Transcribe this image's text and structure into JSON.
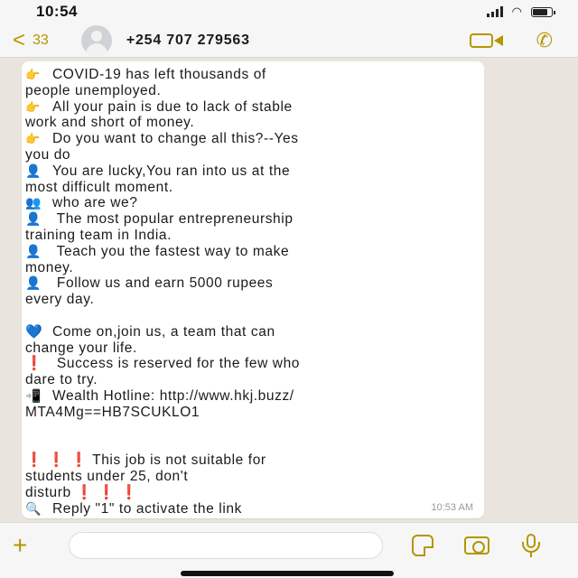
{
  "status_bar": {
    "time": "10:54",
    "battery_level": 0.8
  },
  "header": {
    "back_chevron": "<",
    "back_count": "33",
    "contact_name": "+254 707 279563",
    "icons": {
      "back": "chevron-left-icon",
      "video": "video-call-icon",
      "phone": "phone-call-icon"
    }
  },
  "message": {
    "lines": [
      {
        "emoji": "👉",
        "emoji_name": "pointing-finger-icon",
        "text": "COVID-19 has left thousands of"
      },
      {
        "emoji": "",
        "text": "people unemployed."
      },
      {
        "emoji": "👉",
        "emoji_name": "pointing-finger-icon",
        "text": "All your pain is due to lack of stable"
      },
      {
        "emoji": "",
        "text": "work and short of money."
      },
      {
        "emoji": "👉",
        "emoji_name": "pointing-finger-icon",
        "text": "Do you want to change all this?--Yes"
      },
      {
        "emoji": "",
        "text": "you do"
      },
      {
        "emoji": "👤",
        "emoji_name": "person-icon",
        "text": "You are lucky,You ran into us at the"
      },
      {
        "emoji": "",
        "text": "most difficult moment."
      },
      {
        "emoji": "👥",
        "emoji_name": "people-icon",
        "text": "who are we?"
      },
      {
        "emoji": "👤",
        "emoji_name": "person-icon",
        "text": " The most popular entrepreneurship"
      },
      {
        "emoji": "",
        "text": "training team in India."
      },
      {
        "emoji": "👤",
        "emoji_name": "person-icon",
        "text": " Teach you the fastest way to make"
      },
      {
        "emoji": "",
        "text": "money."
      },
      {
        "emoji": "👤",
        "emoji_name": "person-icon",
        "text": " Follow us and earn 5000 rupees"
      },
      {
        "emoji": "",
        "text": "every day."
      },
      {
        "gap": true
      },
      {
        "emoji": "💙",
        "emoji_name": "blue-heart-icon",
        "text": "Come on,join us, a team that can"
      },
      {
        "emoji": "",
        "text": "change your life."
      },
      {
        "emoji": "❗",
        "emoji_name": "exclamation-icon",
        "text": " Success is reserved for the few who"
      },
      {
        "emoji": "",
        "text": "dare to try."
      },
      {
        "emoji": "📲",
        "emoji_name": "mobile-phone-icon",
        "text": "Wealth Hotline:  http://www.hkj.buzz/"
      },
      {
        "emoji": "",
        "text": "MTA4Mg==HB7SCUKLO1"
      },
      {
        "gap": true
      },
      {
        "gap": true
      },
      {
        "emoji": "❗ ❗ ❗",
        "emoji_name": "exclamation-icon",
        "text": " This job is not suitable for"
      },
      {
        "emoji": "",
        "text": "students under 25, don't"
      },
      {
        "emoji": "",
        "text": "disturb ❗ ❗ ❗"
      },
      {
        "emoji": "🔍",
        "emoji_name": "magnifier-icon",
        "text": "Reply \"1\" to activate the link"
      }
    ],
    "timestamp": "10:53 AM"
  },
  "input_bar": {
    "placeholder": "",
    "icons": {
      "plus": "plus-icon",
      "sticker": "sticker-icon",
      "camera": "camera-icon",
      "mic": "microphone-icon"
    },
    "plus_symbol": "+"
  },
  "colors": {
    "accent": "#b49600",
    "chat_background": "#e9e5de",
    "bubble": "#ffffff",
    "bar_background": "#f6f6f6"
  }
}
